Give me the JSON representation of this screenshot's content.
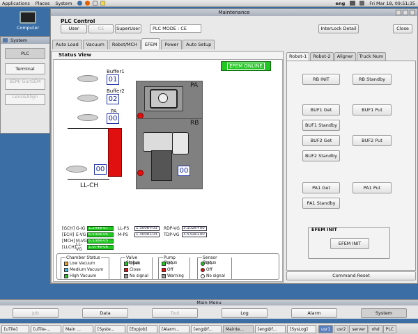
{
  "top_panel": {
    "menus": [
      "Applications",
      "Places",
      "System"
    ],
    "keyboard": "eng",
    "clock": "Fri Mar 18, 09:51:35"
  },
  "desktop": {
    "icon_label": "Computer"
  },
  "system_window": {
    "title": "System",
    "buttons": [
      {
        "label": "PLC",
        "state": "active"
      },
      {
        "label": "Terminal",
        "state": "normal"
      },
      {
        "label": "SEM/ GunSEM",
        "state": "disabled"
      },
      {
        "label": "Lens&Align",
        "state": "disabled"
      }
    ]
  },
  "window": {
    "title": "Maintenance"
  },
  "plc": {
    "title": "PLC Control",
    "user_button": "User",
    "ce_button": "CE",
    "superuser_button": "SuperUser",
    "mode_value": "PLC MODE : CE",
    "interlock_button": "InterLock Detail",
    "close_button": "Close"
  },
  "tabs": [
    "Auto Load",
    "Vacuum",
    "Robot/MCH",
    "EFEM",
    "Power",
    "Auto Setup"
  ],
  "status_view": {
    "title": "Status View",
    "online": "EFEM ONLINE",
    "buffer1_label": "Buffer1",
    "buffer1_value": "01",
    "buffer2_label": "Buffer2",
    "buffer2_value": "02",
    "pa_label": "PA",
    "pa_value": "00",
    "llch_value": "00",
    "llch_label": "LL-CH",
    "pa_chamber_label": "PA",
    "rb_chamber_label": "RB",
    "rb_value": "00"
  },
  "gauges": [
    {
      "group": "[GCH]",
      "name": "G-IG",
      "value": "1.244e-07"
    },
    {
      "group": "[ECH]",
      "name": "E-VG",
      "value": "6.530e-05"
    },
    {
      "group": "[MCH]",
      "name": "M-VG",
      "value": "6.538e-05"
    },
    {
      "group": "[LLCH]",
      "name": "LL-VG",
      "value": "1.074e-06"
    }
  ],
  "gauges_right": [
    {
      "name": "LL-PS",
      "value": "1.300e+03"
    },
    {
      "name": "M-PS",
      "value": "1.300e+03"
    }
  ],
  "gauges_far": [
    {
      "name": "RDP-VG",
      "value": "3.102e+00"
    },
    {
      "name": "TDP-VG",
      "value": "3.531e+00"
    }
  ],
  "legends": {
    "chamber": {
      "title": "Chamber Status",
      "items": [
        {
          "label": "Low Vacuum",
          "color": "#f0a020"
        },
        {
          "label": "Medium Vacuum",
          "color": "#40c0e0"
        },
        {
          "label": "High Vacuum",
          "color": "#22c822"
        }
      ]
    },
    "valve": {
      "title": "Valve Status",
      "items": [
        {
          "label": "Open",
          "color": "#22c822"
        },
        {
          "label": "Close",
          "color": "#e01010"
        },
        {
          "label": "No signal",
          "color": "#999999"
        }
      ]
    },
    "pump": {
      "title": "Pump Status",
      "items": [
        {
          "label": "On",
          "color": "#22c822"
        },
        {
          "label": "Off",
          "color": "#e01010"
        },
        {
          "label": "Warning",
          "color": "#999999"
        }
      ]
    },
    "sensor": {
      "title": "Sensor Status",
      "items": [
        {
          "label": "On",
          "color": "#22c822"
        },
        {
          "label": "Off",
          "color": "#e01010"
        },
        {
          "label": "No signal",
          "color": "#ffffff"
        }
      ]
    }
  },
  "robot_tabs": [
    "Robot-1",
    "Robot-2",
    "Aligner",
    "Truck Num"
  ],
  "robot_buttons": {
    "rb_init": "RB INIT",
    "rb_standby": "RB Standby",
    "buf1_get": "BUF1 Get",
    "buf1_put": "BUF1 Put",
    "buf1_standby": "BUF1 Standby",
    "buf2_get": "BUF2 Get",
    "buf2_put": "BUF2 Put",
    "buf2_standby": "BUF2 Standby",
    "pa1_get": "PA1 Get",
    "pa1_put": "PA1 Put",
    "pa1_standby": "PA1 Standby"
  },
  "efem_init": {
    "title": "EFEM INIT",
    "button": "EFEM INIT"
  },
  "command_reset": "Command Reset",
  "main_menu": {
    "title": "Main Menu",
    "buttons": [
      {
        "label": "Job",
        "state": "disabled"
      },
      {
        "label": "Data",
        "state": "normal"
      },
      {
        "label": "Tool",
        "state": "disabled"
      },
      {
        "label": "Log",
        "state": "normal"
      },
      {
        "label": "Alarm",
        "state": "normal"
      },
      {
        "label": "System",
        "state": "active"
      }
    ]
  },
  "taskbar": {
    "tasks": [
      "[uTile]",
      "[uTile-...",
      "Main ...",
      "[Syste...",
      "[Expjob]",
      "[Alarm...",
      "[eng@f...",
      "Mainte...",
      "[eng@f...",
      "[SysLog]"
    ],
    "workspaces": [
      "usr1",
      "usr2",
      "server",
      "ohd",
      "PLC"
    ]
  }
}
